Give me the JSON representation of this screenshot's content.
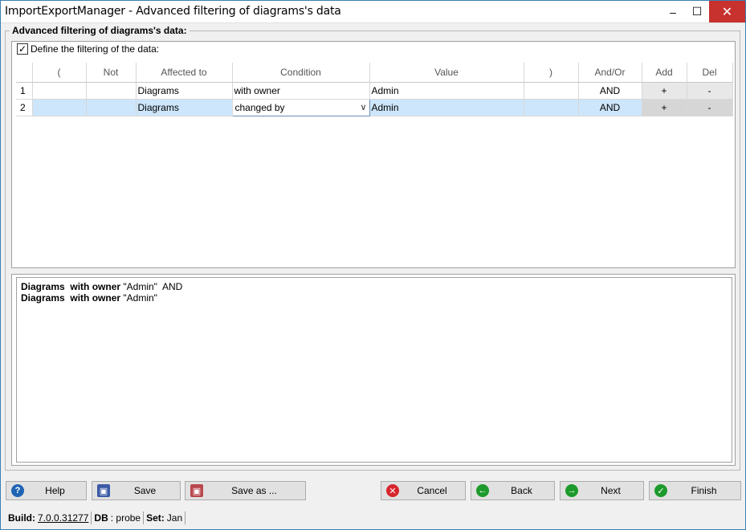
{
  "window": {
    "title": "ImportExportManager - Advanced filtering of diagrams's data",
    "minimize_symbol": "–",
    "maximize_symbol": "☐",
    "close_symbol": "✕"
  },
  "group": {
    "title": "Advanced filtering of diagrams's data:",
    "define_label": "Define the filtering of the data:",
    "define_checked": "✓"
  },
  "grid": {
    "columns": [
      "",
      "(",
      "Not",
      "Affected to",
      "Condition",
      "Value",
      ")",
      "And/Or",
      "Add",
      "Del"
    ],
    "rows": [
      {
        "num": "1",
        "open": "",
        "not": "",
        "affected": "Diagrams",
        "condition": "with owner",
        "value": "Admin",
        "close": "",
        "andor": "AND",
        "add": "+",
        "del": "-"
      },
      {
        "num": "2",
        "open": "",
        "not": "",
        "affected": "Diagrams",
        "condition": "changed by",
        "value": "Admin",
        "close": "",
        "andor": "AND",
        "add": "+",
        "del": "-"
      }
    ]
  },
  "preview": {
    "lines": [
      {
        "subject": "Diagrams",
        "predicate": "with owner",
        "value": "\"Admin\"",
        "conj": "AND"
      },
      {
        "subject": "Diagrams",
        "predicate": "with owner",
        "value": "\"Admin\"",
        "conj": ""
      }
    ]
  },
  "buttons": {
    "help": "Help",
    "save": "Save",
    "save_as": "Save as ...",
    "cancel": "Cancel",
    "back": "Back",
    "next": "Next",
    "finish": "Finish"
  },
  "status": {
    "build_label": "Build:",
    "build_value": "7.0.0.31277",
    "db_label": "DB",
    "db_value": ": probe",
    "set_label": "Set:",
    "set_value": "Jan"
  },
  "colors": {
    "selected_row": "#cde6fb",
    "close_button": "#c7312e",
    "accent_green": "#1d9a2b",
    "accent_red": "#d7252c",
    "accent_blue": "#1f64b4"
  }
}
